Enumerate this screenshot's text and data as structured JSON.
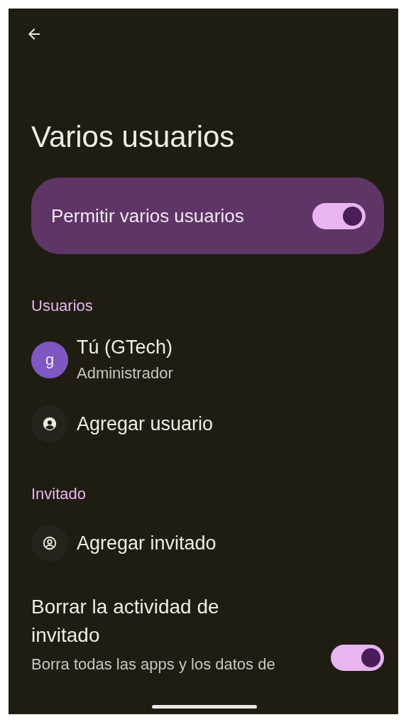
{
  "title": "Varios usuarios",
  "main_toggle": {
    "label": "Permitir varios usuarios",
    "on": true
  },
  "sections": [
    {
      "header": "Usuarios",
      "items": [
        {
          "kind": "user",
          "avatar_letter": "g",
          "name": "Tú (GTech)",
          "subtitle": "Administrador"
        },
        {
          "kind": "add_user",
          "label": "Agregar usuario"
        }
      ]
    },
    {
      "header": "Invitado",
      "items": [
        {
          "kind": "add_guest",
          "label": "Agregar invitado"
        }
      ]
    }
  ],
  "guest_activity": {
    "title": "Borrar la actividad de invitado",
    "description": "Borra todas las apps y los datos de",
    "on": true
  }
}
